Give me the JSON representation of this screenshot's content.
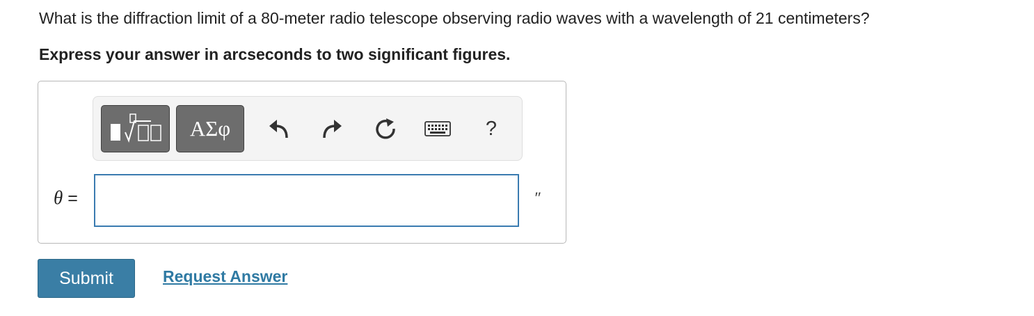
{
  "question": {
    "text": "What is the diffraction limit of a 80-meter radio telescope observing radio waves with a wavelength of 21 centimeters?",
    "instruction": "Express your answer in arcseconds to two significant figures."
  },
  "toolbar": {
    "templates_icon": "templates-icon",
    "greek_label": "ΑΣφ",
    "undo_icon": "undo-icon",
    "redo_icon": "redo-icon",
    "reset_icon": "reset-icon",
    "keyboard_icon": "keyboard-icon",
    "help_label": "?"
  },
  "answer": {
    "variable": "θ",
    "equals": "=",
    "value": "",
    "unit": "″"
  },
  "actions": {
    "submit_label": "Submit",
    "request_label": "Request Answer"
  },
  "colors": {
    "accent": "#3a7ea5",
    "link": "#2f7aa3",
    "input_border": "#3a7bb0",
    "toolbar_button": "#6d6d6d"
  }
}
